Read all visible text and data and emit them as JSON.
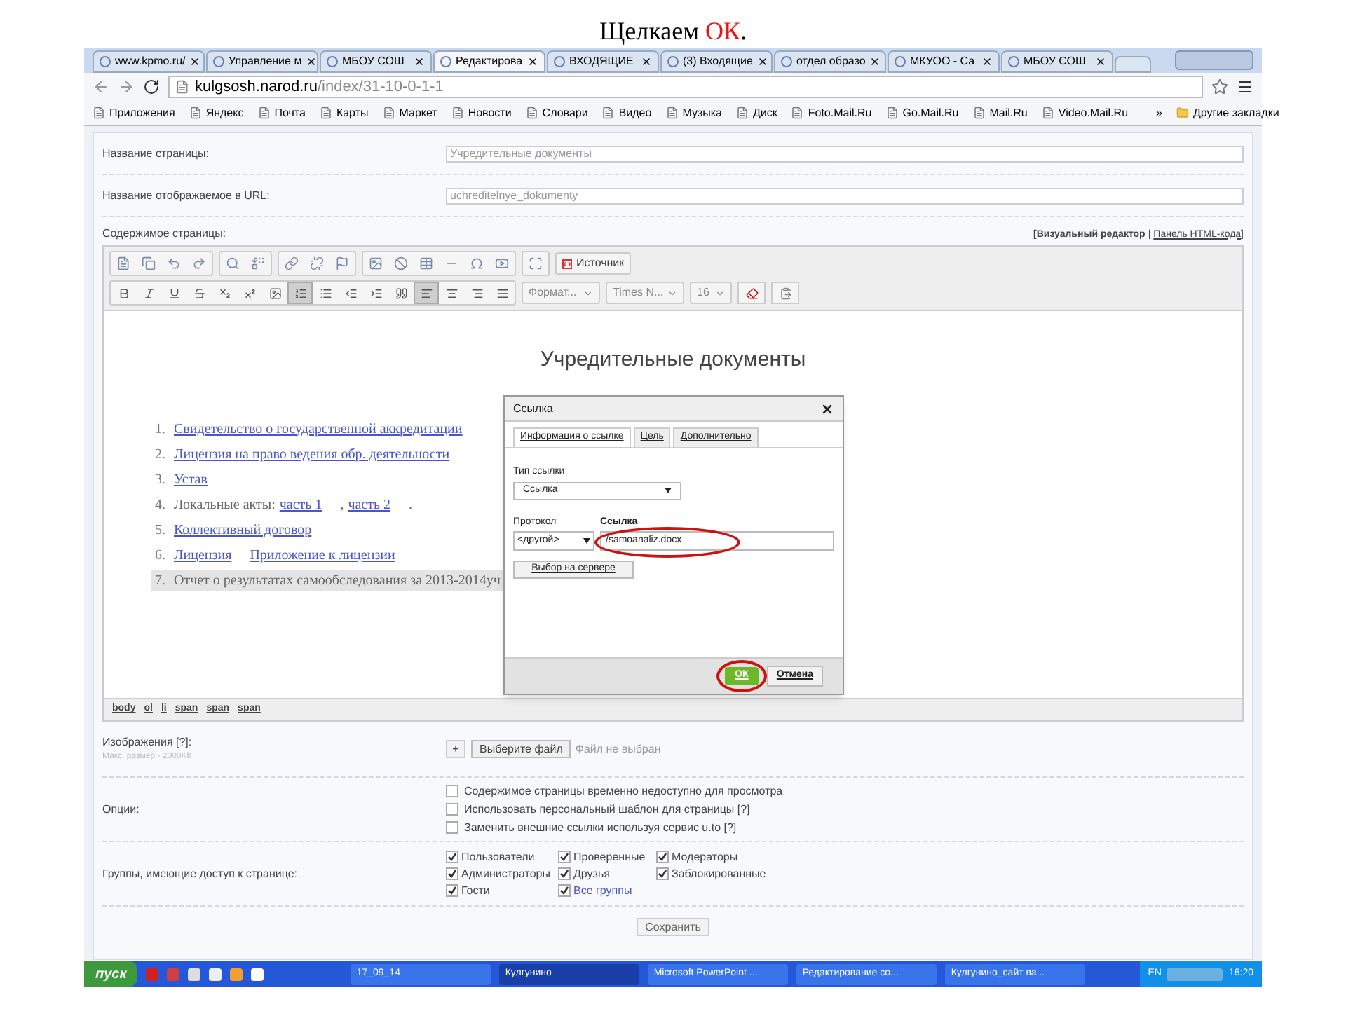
{
  "caption": [
    {
      "text": "Щелкаем ",
      "highlight": false
    },
    {
      "text": "ОК",
      "highlight": true
    },
    {
      "text": ".",
      "highlight": false
    }
  ],
  "browser": {
    "tabs": [
      {
        "label": "www.kpmo.ru/",
        "selected": false
      },
      {
        "label": "Управление м",
        "selected": false
      },
      {
        "label": "МБОУ СОШ",
        "selected": false
      },
      {
        "label": "Редактирова",
        "selected": true
      },
      {
        "label": "ВХОДЯЩИЕ",
        "selected": false
      },
      {
        "label": "(3) Входящие",
        "selected": false
      },
      {
        "label": "отдел образо",
        "selected": false
      },
      {
        "label": "МКУОО - Са",
        "selected": false
      },
      {
        "label": "МБОУ СОШ",
        "selected": false
      }
    ],
    "url_host": "kulgsosh.narod.ru",
    "url_path": "/index/31-10-0-1-1",
    "bookmarks": [
      "Приложения",
      "Яндекс",
      "Почта",
      "Карты",
      "Маркет",
      "Новости",
      "Словари",
      "Видео",
      "Музыка",
      "Диск",
      "Foto.Mail.Ru",
      "Go.Mail.Ru",
      "Mail.Ru",
      "Video.Mail.Ru"
    ],
    "bookmarks_more": "»",
    "other_bookmarks": "Другие закладки"
  },
  "form": {
    "fields": [
      {
        "label": "Название страницы:",
        "value": "Учредительные документы"
      },
      {
        "label": "Название отображаемое в URL:",
        "value": "uchreditelnye_dokumenty"
      }
    ],
    "content_label": "Содержимое страницы:",
    "visual_editor": "[Визуальный редактор",
    "separator": "|",
    "html_panel": "Панель HTML-кода]",
    "source_button": "Источник",
    "format_select": "Формат...",
    "font_select": "Times N...",
    "size_select": "16",
    "format_buttons": [
      {
        "kind": "bold",
        "pressed": false
      },
      {
        "kind": "italic",
        "pressed": false
      },
      {
        "kind": "underline",
        "pressed": false
      },
      {
        "kind": "strike",
        "pressed": false
      },
      {
        "kind": "subscript",
        "pressed": false
      },
      {
        "kind": "superscript",
        "pressed": false
      },
      {
        "kind": "image",
        "pressed": false
      },
      {
        "kind": "numbered",
        "pressed": true
      },
      {
        "kind": "bulleted",
        "pressed": false
      },
      {
        "kind": "outdent",
        "pressed": false
      },
      {
        "kind": "indent",
        "pressed": false
      },
      {
        "kind": "quote",
        "pressed": false
      },
      {
        "kind": "align-left",
        "pressed": true
      },
      {
        "kind": "align-center",
        "pressed": false
      },
      {
        "kind": "align-right",
        "pressed": false
      },
      {
        "kind": "justify",
        "pressed": false
      }
    ],
    "doc_title": "Учредительные документы",
    "items": [
      {
        "number": "1.",
        "highlighted": false,
        "parts": [
          {
            "text": "Свидетельство о государственной аккредитации",
            "link": true
          }
        ]
      },
      {
        "number": "2.",
        "highlighted": false,
        "parts": [
          {
            "text": "Лицензия на право ведения обр. деятельности",
            "link": true
          }
        ]
      },
      {
        "number": "3.",
        "highlighted": false,
        "parts": [
          {
            "text": "Устав",
            "link": true
          }
        ]
      },
      {
        "number": "4.",
        "highlighted": false,
        "parts": [
          {
            "text": "Локальные акты:",
            "link": false
          },
          {
            "text": "часть 1",
            "link": true
          },
          {
            "text": ",",
            "link": false
          },
          {
            "text": "часть 2",
            "link": true
          },
          {
            "text": ".",
            "link": false
          }
        ]
      },
      {
        "number": "5.",
        "highlighted": false,
        "parts": [
          {
            "text": "Коллективный договор",
            "link": true
          }
        ]
      },
      {
        "number": "6.",
        "highlighted": false,
        "parts": [
          {
            "text": "Лицензия",
            "link": true
          },
          {
            "text": "Приложение к лицензии",
            "link": true
          }
        ]
      },
      {
        "number": "7.",
        "highlighted": true,
        "parts": [
          {
            "text": "Отчет о результатах самообследования за 2013-2014уч",
            "link": false
          }
        ]
      }
    ],
    "path": [
      "body",
      "ol",
      "li",
      "span",
      "span",
      "span"
    ],
    "images_label": "Изображения [?]:",
    "images_hint": "Макс. размер - 2000Kb",
    "add_button": "+",
    "file_button": "Выберите файл",
    "file_status": "Файл не выбран",
    "options_label": "Опции:",
    "options": [
      {
        "label": "Содержимое страницы временно недоступно для просмотра",
        "checked": false
      },
      {
        "label": "Использовать персональный шаблон для страницы [?]",
        "checked": false
      },
      {
        "label": "Заменить внешние ссылки используя сервис u.to [?]",
        "checked": false
      }
    ],
    "groups_label": "Группы, имеющие доступ к странице:",
    "groups": [
      {
        "label": "Пользователи",
        "checked": true,
        "link": false
      },
      {
        "label": "Проверенные",
        "checked": true,
        "link": false
      },
      {
        "label": "Модераторы",
        "checked": true,
        "link": false
      },
      {
        "label": "Администраторы",
        "checked": true,
        "link": false
      },
      {
        "label": "Друзья",
        "checked": true,
        "link": false
      },
      {
        "label": "Заблокированные",
        "checked": true,
        "link": false
      },
      {
        "label": "Гости",
        "checked": true,
        "link": false
      },
      {
        "label": "Все группы",
        "checked": true,
        "link": true
      }
    ],
    "save_button": "Сохранить"
  },
  "dialog": {
    "title": "Ссылка",
    "tabs": [
      {
        "label": "Информация о ссылке",
        "selected": true
      },
      {
        "label": "Цель",
        "selected": false
      },
      {
        "label": "Дополнительно",
        "selected": false
      }
    ],
    "link_type_label": "Тип ссылки",
    "link_type": "Ссылка",
    "protocol_label": "Протокол",
    "protocol": "<другой>",
    "url_label": "Ссылка",
    "url": "/samoanaliz.docx",
    "server_button": "Выбор на сервере",
    "ok_button": "ОК",
    "cancel_button": "Отмена"
  },
  "taskbar": {
    "start": "пуск",
    "tasks": [
      {
        "label": "17_09_14",
        "selected": false
      },
      {
        "label": "Кулгунино",
        "selected": true
      },
      {
        "label": "Microsoft PowerPoint ...",
        "selected": false
      },
      {
        "label": "Редактирование со...",
        "selected": false
      },
      {
        "label": "Кулгунино_сайт ва...",
        "selected": false
      }
    ],
    "language": "EN",
    "time": "16:20"
  }
}
